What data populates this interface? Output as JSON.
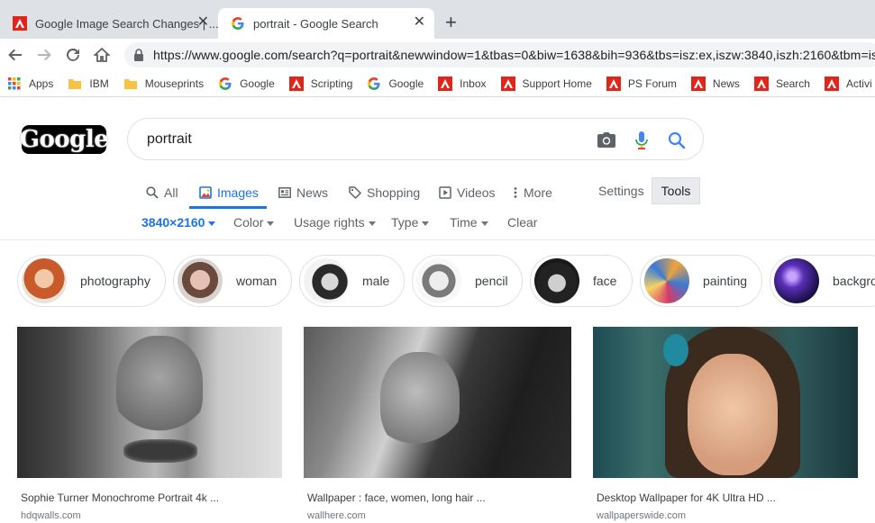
{
  "browser": {
    "tabs": [
      {
        "title": "Google Image Search Changes | ...",
        "icon": "adobe-icon",
        "active": false
      },
      {
        "title": "portrait - Google Search",
        "icon": "google-g-icon",
        "active": true
      }
    ],
    "url": "https://www.google.com/search?q=portrait&newwindow=1&tbas=0&biw=1638&bih=936&tbs=isz:ex,iszw:3840,iszh:2160&tbm=is",
    "bookmarks": [
      {
        "label": "Apps",
        "icon": "apps-grid-icon"
      },
      {
        "label": "IBM",
        "icon": "folder-icon"
      },
      {
        "label": "Mouseprints",
        "icon": "folder-icon"
      },
      {
        "label": "Google",
        "icon": "google-g-icon"
      },
      {
        "label": "Scripting",
        "icon": "adobe-icon"
      },
      {
        "label": "Google",
        "icon": "google-g-icon"
      },
      {
        "label": "Inbox",
        "icon": "adobe-icon"
      },
      {
        "label": "Support Home",
        "icon": "adobe-icon"
      },
      {
        "label": "PS Forum",
        "icon": "adobe-icon"
      },
      {
        "label": "News",
        "icon": "adobe-icon"
      },
      {
        "label": "Search",
        "icon": "adobe-icon"
      },
      {
        "label": "Activi",
        "icon": "adobe-icon"
      }
    ]
  },
  "search": {
    "logo_text": "Google",
    "query": "portrait"
  },
  "tabs": [
    {
      "label": "All",
      "icon": "search-icon",
      "active": false
    },
    {
      "label": "Images",
      "icon": "image-icon",
      "active": true
    },
    {
      "label": "News",
      "icon": "news-icon",
      "active": false
    },
    {
      "label": "Shopping",
      "icon": "tag-icon",
      "active": false
    },
    {
      "label": "Videos",
      "icon": "video-icon",
      "active": false
    },
    {
      "label": "More",
      "icon": "more-vert-icon",
      "active": false
    }
  ],
  "settings_label": "Settings",
  "tools_label": "Tools",
  "tool_filters": [
    {
      "label": "3840×2160",
      "active": true
    },
    {
      "label": "Color",
      "active": false
    },
    {
      "label": "Usage rights",
      "active": false
    },
    {
      "label": "Type",
      "active": false
    },
    {
      "label": "Time",
      "active": false
    },
    {
      "label": "Clear",
      "active": false
    }
  ],
  "chips": [
    {
      "label": "photography"
    },
    {
      "label": "woman"
    },
    {
      "label": "male"
    },
    {
      "label": "pencil"
    },
    {
      "label": "face"
    },
    {
      "label": "painting"
    },
    {
      "label": "backgro"
    }
  ],
  "results": [
    {
      "caption": "Sophie Turner Monochrome Portrait 4k ...",
      "source": "hdqwalls.com"
    },
    {
      "caption": "Wallpaper : face, women, long hair ...",
      "source": "wallhere.com"
    },
    {
      "caption": "Desktop Wallpaper for 4K Ultra HD ...",
      "source": "wallpaperswide.com"
    }
  ],
  "colors": {
    "accent": "#1a73e8",
    "tabstrip": "#dee1e6",
    "adobe_red": "#e1251b"
  }
}
